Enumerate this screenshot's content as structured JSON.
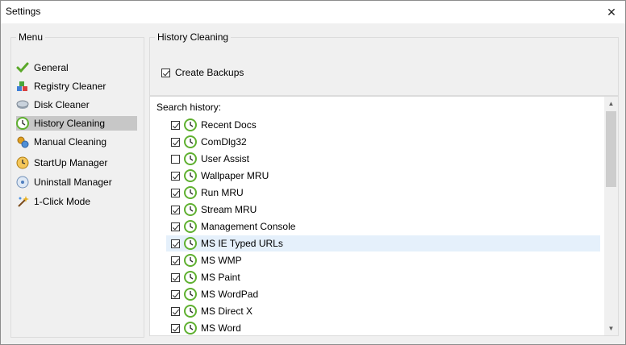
{
  "window": {
    "title": "Settings",
    "close_glyph": "✕"
  },
  "menu": {
    "legend": "Menu",
    "items": [
      {
        "label": "General",
        "icon": "checkmark-icon",
        "selected": false
      },
      {
        "label": "Registry Cleaner",
        "icon": "registry-cubes-icon",
        "selected": false
      },
      {
        "label": "Disk Cleaner",
        "icon": "disk-icon",
        "selected": false
      },
      {
        "label": "History Cleaning",
        "icon": "clock-icon",
        "selected": true
      },
      {
        "label": "Manual Cleaning",
        "icon": "gears-icon",
        "selected": false
      },
      {
        "label": "StartUp Manager",
        "icon": "startup-clock-icon",
        "selected": false
      },
      {
        "label": "Uninstall Manager",
        "icon": "uninstall-disc-icon",
        "selected": false
      },
      {
        "label": "1-Click Mode",
        "icon": "magic-wand-icon",
        "selected": false
      }
    ]
  },
  "history": {
    "legend": "History Cleaning",
    "create_backups": {
      "label": "Create Backups",
      "checked": true
    },
    "search_label": "Search history:",
    "items": [
      {
        "label": "Recent Docs",
        "checked": true
      },
      {
        "label": "ComDlg32",
        "checked": true
      },
      {
        "label": "User Assist",
        "checked": false
      },
      {
        "label": "Wallpaper MRU",
        "checked": true
      },
      {
        "label": "Run MRU",
        "checked": true
      },
      {
        "label": "Stream MRU",
        "checked": true
      },
      {
        "label": "Management Console",
        "checked": true
      },
      {
        "label": "MS IE Typed URLs",
        "checked": true,
        "highlighted": true
      },
      {
        "label": "MS WMP",
        "checked": true
      },
      {
        "label": "MS Paint",
        "checked": true
      },
      {
        "label": "MS WordPad",
        "checked": true
      },
      {
        "label": "MS Direct X",
        "checked": true
      },
      {
        "label": "MS Word",
        "checked": true
      }
    ]
  },
  "colors": {
    "selection": "#c7c7c7",
    "row_highlight": "#e5f0fb",
    "clock_green": "#5fb030"
  }
}
